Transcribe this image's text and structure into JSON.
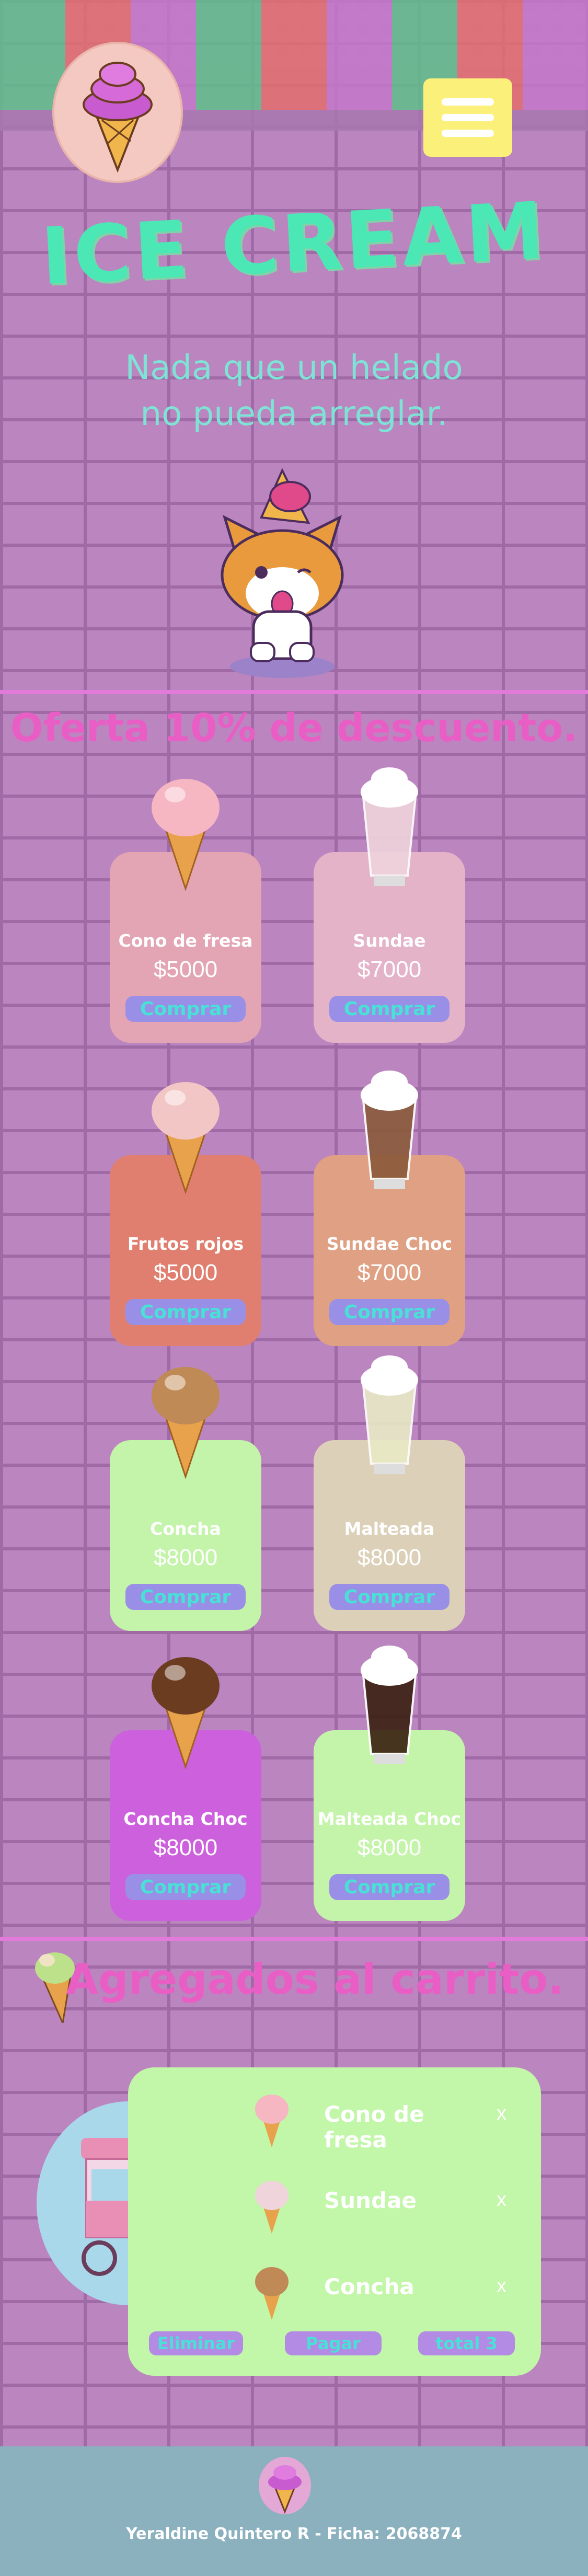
{
  "header": {
    "title": "ICE CREAM",
    "tagline_line1": "Nada que un helado",
    "tagline_line2": "no pueda arreglar.",
    "logo_icon": "ice-cream-cone-icon",
    "menu_icon": "hamburger-menu-icon"
  },
  "offers": {
    "title": "Oferta 10% de descuento.",
    "buy_label": "Comprar",
    "products": [
      {
        "name": "Cono de fresa",
        "price": "$5000",
        "color": "#e3a4b3"
      },
      {
        "name": "Sundae",
        "price": "$7000",
        "color": "#e4b3c8"
      },
      {
        "name": "Frutos rojos",
        "price": "$5000",
        "color": "#e07f6f"
      },
      {
        "name": "Sundae Choc",
        "price": "$7000",
        "color": "#e0a083"
      },
      {
        "name": "Concha",
        "price": "$8000",
        "color": "#c3f4a9"
      },
      {
        "name": "Malteada",
        "price": "$8000",
        "color": "#dcd1b8"
      },
      {
        "name": "Concha Choc",
        "price": "$8000",
        "color": "#cd60dd"
      },
      {
        "name": "Malteada Choc",
        "price": "$8000",
        "color": "#c3f4a9"
      }
    ]
  },
  "cart": {
    "title": "Agregados al carrito.",
    "items": [
      {
        "name": "Cono de fresa",
        "remove": "x"
      },
      {
        "name": "Sundae",
        "remove": "x"
      },
      {
        "name": "Concha",
        "remove": "x"
      }
    ],
    "buttons": {
      "delete": "Eliminar",
      "pay": "Pagar",
      "total": "total 3"
    }
  },
  "footer": {
    "text": "Yeraldine Quintero R - Ficha: 2068874"
  },
  "colors": {
    "accent_pink": "#e95ec5",
    "accent_mint": "#4be7b4",
    "panel_green": "#c2f6a8",
    "button_purple": "#9a8fe6"
  }
}
